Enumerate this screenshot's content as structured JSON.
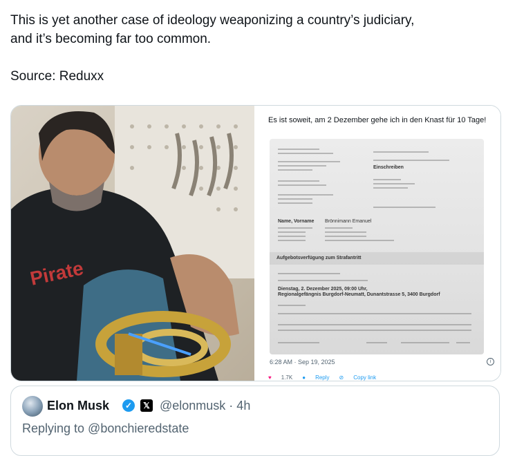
{
  "post": {
    "line1": "This is yet another case of ideology weaponizing a country’s judiciary,",
    "line2": "and it’s becoming far too common.",
    "source": "Source: Reduxx"
  },
  "embedded": {
    "text": "Es ist soweit, am 2 Dezember gehe ich in den Knast für 10 Tage!",
    "timestamp": "6:28 AM · Sep 19, 2025",
    "likes": "1.7K",
    "reply_label": "Reply",
    "copy_link_label": "Copy link",
    "letter": {
      "heading": "Aufgebotsverfügung zum Strafantritt",
      "date_line": "Dienstag, 2. Dezember 2025, 09:00 Uhr,",
      "place_line": "Regionalgefängnis Burgdorf-Neumatt, Dunantstrasse 5, 3400 Burgdorf",
      "name_label": "Name, Vorname",
      "name_value": "Brönnimann Emanuel",
      "recipient": "Einschreiben"
    }
  },
  "quote": {
    "name": "Elon Musk",
    "handle": "@elonmusk · 4h",
    "replying": "Replying to @bonchieredstate"
  },
  "colors": {
    "accent": "#1d9bf0",
    "like": "#f91880",
    "muted": "#536471"
  }
}
